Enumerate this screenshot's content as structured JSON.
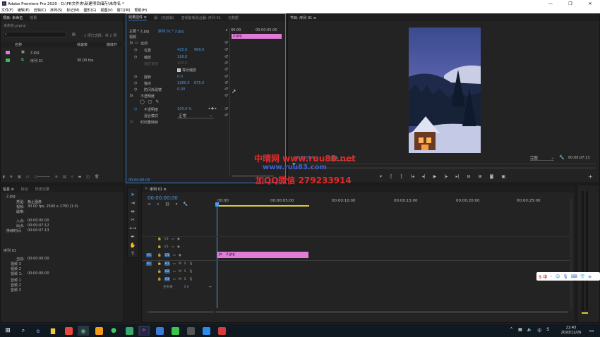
{
  "app": {
    "title": "Adobe Premiere Pro 2020 - D:\\PR文件夹\\新建项目储存\\未命名 *"
  },
  "menu": [
    "文件(F)",
    "编辑(E)",
    "剪辑(C)",
    "序列(S)",
    "标记(M)",
    "图形(G)",
    "视图(V)",
    "窗口(W)",
    "帮助(H)"
  ],
  "project_panel": {
    "tabs": [
      "项目: 未命名",
      "效果"
    ],
    "project_name": "未命名.prproj",
    "selection_info": "1 项已选择，共 2 项",
    "columns": [
      "名称",
      "帧速率",
      "媒体开"
    ],
    "items": [
      {
        "name": "2.jpg",
        "fps": "",
        "color": "#e07bd8"
      },
      {
        "name": "序列 01",
        "fps": "30.00 fps",
        "color": "#3dbb4f"
      }
    ]
  },
  "effect_controls": {
    "tabs": [
      "效果控件 ≡",
      "源：(无剪辑)",
      "音频剪辑混合器: 序列 01",
      "元数据"
    ],
    "source": "主要 * 2.jpg",
    "target": "序列 01 * 2.jpg",
    "timecodes": [
      "00:00",
      "00:00:05:00"
    ],
    "section_video": "视频",
    "clip_label": "2.jpg",
    "motion": "运动",
    "position_label": "位置",
    "position_x": "425.0",
    "position_y": "969.0",
    "scale_label": "缩放",
    "scale_value": "116.0",
    "scale_width_label": "缩放宽度",
    "scale_width_value": "100.0",
    "uniform_scale": "等比缩放",
    "rotation_label": "旋转",
    "rotation_value": "0.0",
    "anchor_label": "锚点",
    "anchor_x": "1260.0",
    "anchor_y": "875.0",
    "flicker_label": "防闪烁滤镜",
    "flicker_value": "0.00",
    "opacity_section": "不透明度",
    "opacity_label": "不透明度",
    "opacity_value": "100.0 %",
    "blend_label": "混合模式",
    "blend_value": "正常",
    "time_remap": "时间重映射",
    "bottom_timecode": "00:00:00:00"
  },
  "program_monitor": {
    "tab": "节目: 序列 01 ≡",
    "timecode_left": "00:00:00:00",
    "fit": "适合",
    "quality": "完整",
    "timecode_right": "00:00:07:13"
  },
  "watermark": {
    "line1": "中晴网 www.ruu83.net",
    "line2": "www.ruu83.com",
    "line3": "加QQ微信 279233914"
  },
  "info_panel": {
    "tabs": [
      "信息 ≡",
      "标记",
      "历史记录"
    ],
    "file_name": "2.jpg",
    "type_label": "类型:",
    "type_value": "静止图像",
    "video_label": "视频:",
    "video_value": "30.00 fps, 2500 x 1750 (1.0)",
    "tape_label": "磁带:",
    "in_label": "入点:",
    "in_value": "00:00:00:00",
    "out_label": "出点:",
    "out_value": "00:00:07:12",
    "dur_label": "持续时间:",
    "dur_value": "00:00:07:13",
    "seq_label": "序列 01",
    "current_label": "当前:",
    "current_value": "00:00:00:00",
    "v3": "视频 3",
    "v2": "视频 2",
    "v1": "视频 1:",
    "v1_value": "00:00:00:00",
    "a1": "音频 1",
    "a2": "音频 2",
    "a3": "音频 3"
  },
  "timeline": {
    "tab": "序列 01 ≡",
    "timecode": "00:00:00:00",
    "ruler": [
      "00:00",
      "00:00:05:00",
      "00:00:10:00",
      "00:00:15:00",
      "00:00:20:00",
      "00:00:25:00"
    ],
    "tracks_video": [
      "V3",
      "V2",
      "V1"
    ],
    "tracks_audio": [
      "A1",
      "A2",
      "A3"
    ],
    "source_patch_v": "V1",
    "source_patch_a": "A1",
    "master_label": "主声道",
    "master_value": "0.0",
    "clip_label": "2.jpg"
  },
  "ime": {
    "label": "S 中"
  },
  "taskbar": {
    "time": "22:43",
    "date": "2020/12/26",
    "ime_lang": "中"
  },
  "colors": {
    "accent": "#4a9be8",
    "clip": "#e07bd8",
    "sequence": "#3dbb4f",
    "watermark": "#e52a2a",
    "watermark_blue": "#3f63d6"
  }
}
